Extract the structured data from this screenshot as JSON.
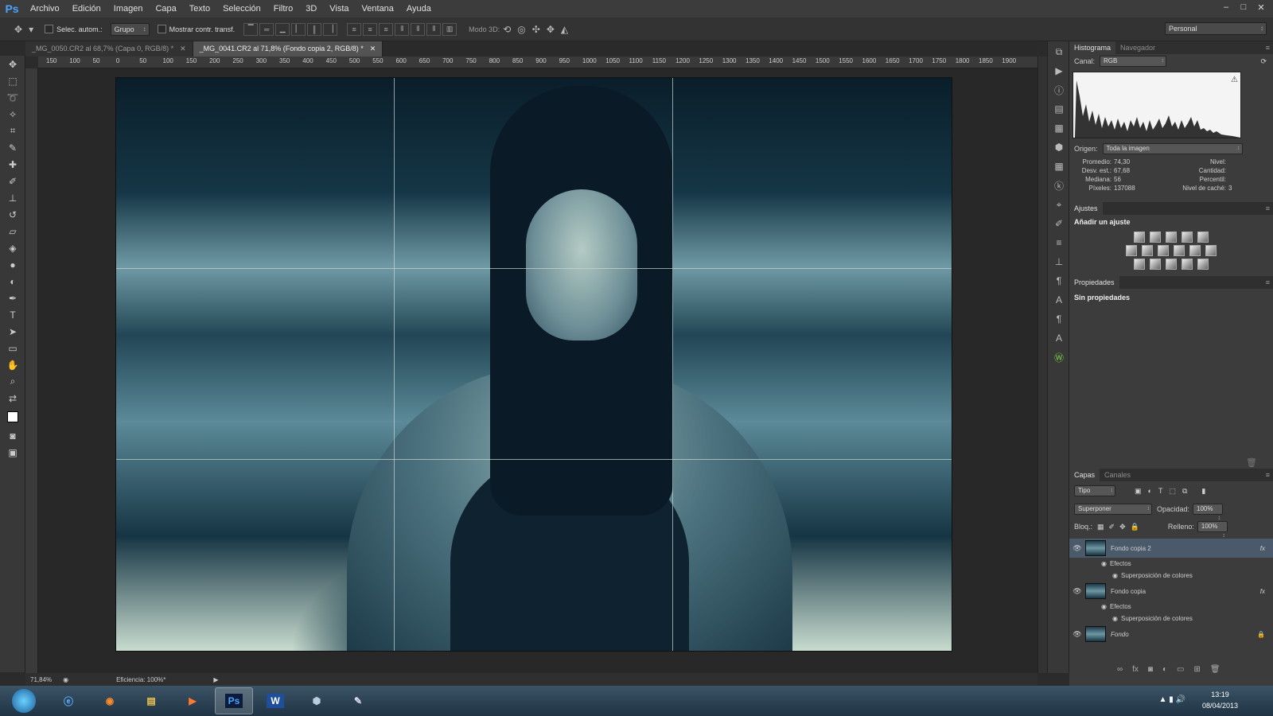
{
  "app": {
    "logo": "Ps",
    "title_bar_buttons": [
      "–",
      "□",
      "✕"
    ]
  },
  "menu": [
    "Archivo",
    "Edición",
    "Imagen",
    "Capa",
    "Texto",
    "Selección",
    "Filtro",
    "3D",
    "Vista",
    "Ventana",
    "Ayuda"
  ],
  "options": {
    "auto_select_label": "Selec. autom.:",
    "auto_select_value": "Grupo",
    "transform_label": "Mostrar contr. transf.",
    "mode3d_label": "Modo 3D:",
    "workspace": "Personal"
  },
  "tabs": [
    {
      "label": "_MG_0050.CR2 al 68,7% (Capa 0, RGB/8) *",
      "active": false
    },
    {
      "label": "_MG_0041.CR2 al 71,8% (Fondo copia 2, RGB/8) *",
      "active": true
    }
  ],
  "ruler_labels": [
    "150",
    "100",
    "50",
    "0",
    "50",
    "100",
    "150",
    "200",
    "250",
    "300",
    "350",
    "400",
    "450",
    "500",
    "550",
    "600",
    "650",
    "700",
    "750",
    "800",
    "850",
    "900",
    "950",
    "1000",
    "1050",
    "1100",
    "1150",
    "1200",
    "1250",
    "1300",
    "1350",
    "1400",
    "1450",
    "1500",
    "1550",
    "1600",
    "1650",
    "1700",
    "1750",
    "1800",
    "1850",
    "1900"
  ],
  "status": {
    "zoom": "71,84%",
    "efficiency": "Eficiencia: 100%*"
  },
  "histogram": {
    "tabs": [
      "Histograma",
      "Navegador"
    ],
    "channel_label": "Canal:",
    "channel_value": "RGB",
    "source_label": "Origen:",
    "source_value": "Toda la imagen",
    "stats_left": [
      {
        "label": "Promedio:",
        "value": "74,30"
      },
      {
        "label": "Desv. est.:",
        "value": "67,68"
      },
      {
        "label": "Mediana:",
        "value": "56"
      },
      {
        "label": "Píxeles:",
        "value": "137088"
      }
    ],
    "stats_right": [
      {
        "label": "Nivel:",
        "value": ""
      },
      {
        "label": "Cantidad:",
        "value": ""
      },
      {
        "label": "Percentil:",
        "value": ""
      },
      {
        "label": "Nivel de caché:",
        "value": "3"
      }
    ]
  },
  "adjustments": {
    "tab": "Ajustes",
    "title": "Añadir un ajuste"
  },
  "properties": {
    "tab": "Propiedades",
    "text": "Sin propiedades"
  },
  "layers": {
    "tabs": [
      "Capas",
      "Canales"
    ],
    "filter": "Tipo",
    "blend_mode": "Superponer",
    "opacity_label": "Opacidad:",
    "opacity": "100%",
    "lock_label": "Bloq.:",
    "fill_label": "Relleno:",
    "fill": "100%",
    "items": [
      {
        "name": "Fondo copia 2",
        "effects": "Efectos",
        "effect": "Superposición de colores",
        "selected": true
      },
      {
        "name": "Fondo copia",
        "effects": "Efectos",
        "effect": "Superposición de colores",
        "selected": false
      },
      {
        "name": "Fondo",
        "selected": false
      }
    ]
  },
  "taskbar": {
    "apps": [
      "ie-icon",
      "firefox-icon",
      "explorer-icon",
      "media-icon",
      "photoshop-icon",
      "word-icon",
      "3d-icon",
      "paint-icon"
    ],
    "ps_label": "Ps",
    "word_label": "W",
    "time": "13:19",
    "date": "08/04/2013"
  }
}
